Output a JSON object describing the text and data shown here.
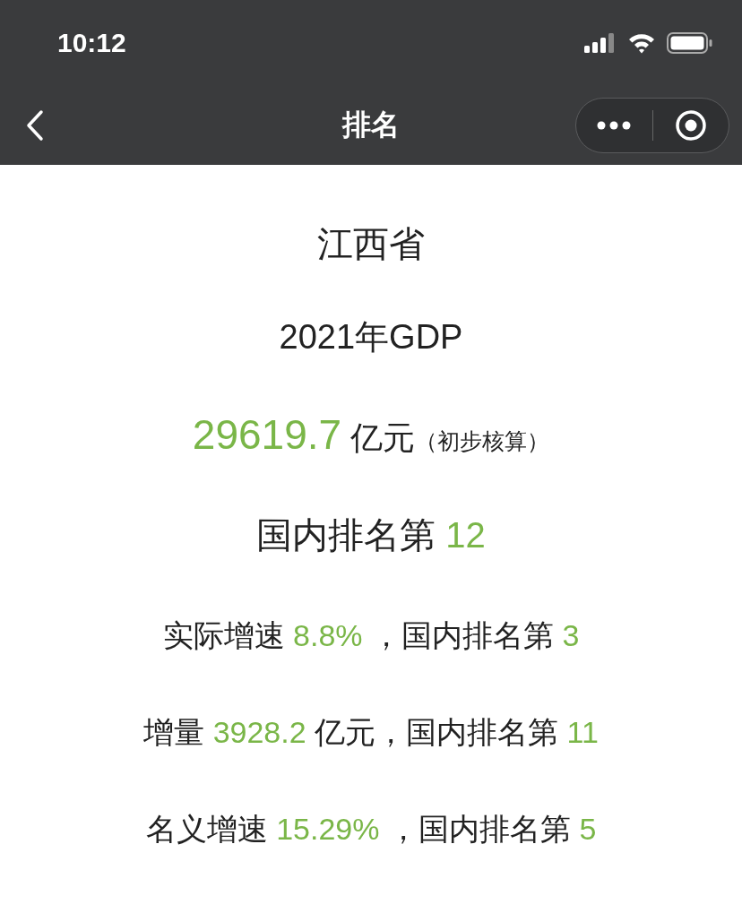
{
  "status_bar": {
    "time": "10:12"
  },
  "nav": {
    "title": "排名"
  },
  "content": {
    "province": "江西省",
    "heading": "2021年GDP",
    "lines": [
      {
        "kind": "headline",
        "parts": [
          {
            "text": "29619.7",
            "kind": "value"
          },
          {
            "text": " 亿元",
            "kind": "text"
          },
          {
            "text": "（初步核算）",
            "kind": "note"
          }
        ]
      },
      {
        "kind": "rank",
        "parts": [
          {
            "text": "国内排名第 ",
            "kind": "text"
          },
          {
            "text": "12",
            "kind": "value"
          }
        ]
      },
      {
        "kind": "detail",
        "parts": [
          {
            "text": "实际增速 ",
            "kind": "text"
          },
          {
            "text": "8.8%",
            "kind": "value"
          },
          {
            "text": " ，国内排名第 ",
            "kind": "text"
          },
          {
            "text": "3",
            "kind": "value"
          }
        ]
      },
      {
        "kind": "detail",
        "parts": [
          {
            "text": "增量 ",
            "kind": "text"
          },
          {
            "text": "3928.2",
            "kind": "value"
          },
          {
            "text": " 亿元，国内排名第 ",
            "kind": "text"
          },
          {
            "text": "11",
            "kind": "value"
          }
        ]
      },
      {
        "kind": "detail",
        "parts": [
          {
            "text": "名义增速 ",
            "kind": "text"
          },
          {
            "text": "15.29%",
            "kind": "value"
          },
          {
            "text": " ，国内排名第 ",
            "kind": "text"
          },
          {
            "text": "5",
            "kind": "value"
          }
        ]
      }
    ]
  }
}
